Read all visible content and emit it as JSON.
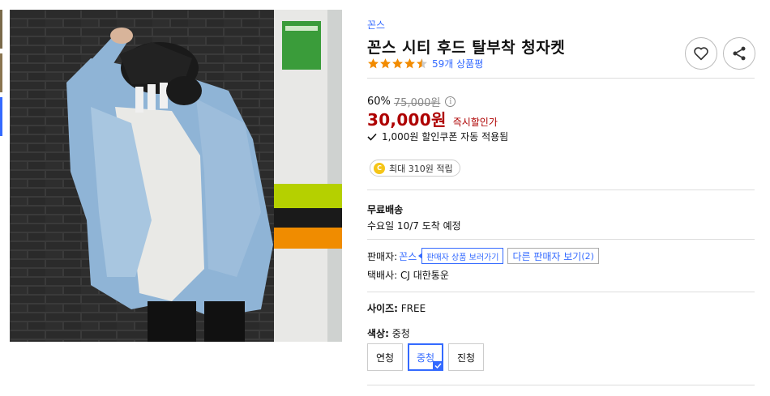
{
  "gallery": {
    "thumbnails": [
      "thumb-1",
      "thumb-2",
      "thumb-3"
    ],
    "active_index": 2
  },
  "product": {
    "brand": "꼰스",
    "title": "꼰스 시티 후드 탈부착 청자켓",
    "rating": 4.5,
    "review_link": "59개 상품평",
    "discount_rate": "60%",
    "original_price": "75,000원",
    "sale_price": "30,000원",
    "instant_discount_label": "즉시할인가",
    "coupon_text": "1,000원 할인쿠폰 자동 적용됨",
    "point_text": "최대 310원 적립",
    "point_icon": "C"
  },
  "shipping": {
    "title": "무료배송",
    "arrival": "수요일 10/7 도착 예정"
  },
  "seller": {
    "label": "판매자:",
    "name": "꼰스",
    "view_products": "판매자 상품 보러가기",
    "other_sellers": "다른 판매자 보기",
    "other_count": "(2)",
    "courier": "택배사: CJ 대한통운"
  },
  "options": {
    "size_label": "사이즈:",
    "size_value": "FREE",
    "color_label": "색상:",
    "color_value": "중청",
    "colors": [
      "연청",
      "중청",
      "진청"
    ],
    "selected_color": "중청"
  },
  "icons": {
    "heart": "heart-icon",
    "share": "share-icon",
    "info": "info-icon",
    "check": "check-icon",
    "coin": "coin-icon"
  },
  "colors": {
    "link_blue": "#346aff",
    "price_red": "#ae0000",
    "star_orange": "#f28b00"
  }
}
